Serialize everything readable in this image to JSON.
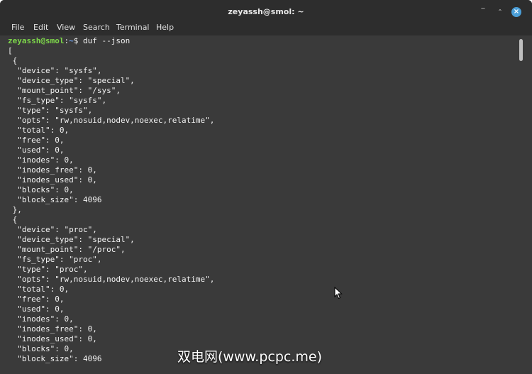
{
  "window": {
    "title": "zeyassh@smol: ~"
  },
  "controls": {
    "minimize": "‾",
    "maximize": "⌃",
    "close": "×"
  },
  "menu": [
    "File",
    "Edit",
    "View",
    "Search",
    "Terminal",
    "Help"
  ],
  "prompt": {
    "user": "zeyassh@smol",
    "sep": ":",
    "path": "~",
    "dollar": "$ ",
    "command": "duf --json"
  },
  "output": [
    "[",
    " {",
    "  \"device\": \"sysfs\",",
    "  \"device_type\": \"special\",",
    "  \"mount_point\": \"/sys\",",
    "  \"fs_type\": \"sysfs\",",
    "  \"type\": \"sysfs\",",
    "  \"opts\": \"rw,nosuid,nodev,noexec,relatime\",",
    "  \"total\": 0,",
    "  \"free\": 0,",
    "  \"used\": 0,",
    "  \"inodes\": 0,",
    "  \"inodes_free\": 0,",
    "  \"inodes_used\": 0,",
    "  \"blocks\": 0,",
    "  \"block_size\": 4096",
    " },",
    " {",
    "  \"device\": \"proc\",",
    "  \"device_type\": \"special\",",
    "  \"mount_point\": \"/proc\",",
    "  \"fs_type\": \"proc\",",
    "  \"type\": \"proc\",",
    "  \"opts\": \"rw,nosuid,nodev,noexec,relatime\",",
    "  \"total\": 0,",
    "  \"free\": 0,",
    "  \"used\": 0,",
    "  \"inodes\": 0,",
    "  \"inodes_free\": 0,",
    "  \"inodes_used\": 0,",
    "  \"blocks\": 0,",
    "  \"block_size\": 4096"
  ],
  "watermark": "双电网(www.pcpc.me)",
  "colors": {
    "background": "#3a3a3a",
    "titlebar": "#2d2d2d",
    "prompt_user": "#7dd64a",
    "prompt_path": "#6f9ee8",
    "close_button": "#4b9fd8"
  },
  "icons": {
    "cursor": "mouse-pointer-icon"
  }
}
